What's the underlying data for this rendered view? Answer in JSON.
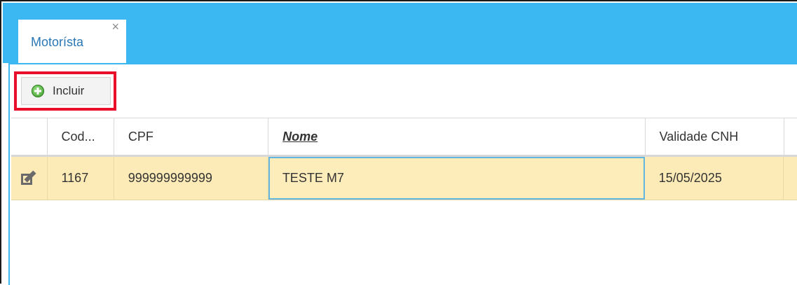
{
  "tabs": [
    {
      "label": "Motorísta",
      "close_glyph": "×",
      "active": true
    }
  ],
  "toolbar": {
    "incluir_label": "Incluir",
    "incluir_icon": "add-circle-icon",
    "highlight_color": "#e8102a"
  },
  "grid": {
    "columns": [
      "Cod...",
      "CPF",
      "Nome",
      "Validade CNH"
    ],
    "sorted_column": "Nome",
    "rows": [
      {
        "edit_icon": "edit-icon",
        "cod": "1167",
        "cpf": "999999999999",
        "nome": "TESTE M7",
        "validade_cnh": "15/05/2025",
        "selected": true
      }
    ]
  },
  "colors": {
    "tabbar": "#3bb8f1",
    "selected_row": "#fcebb6",
    "tab_text": "#2a77b5"
  }
}
